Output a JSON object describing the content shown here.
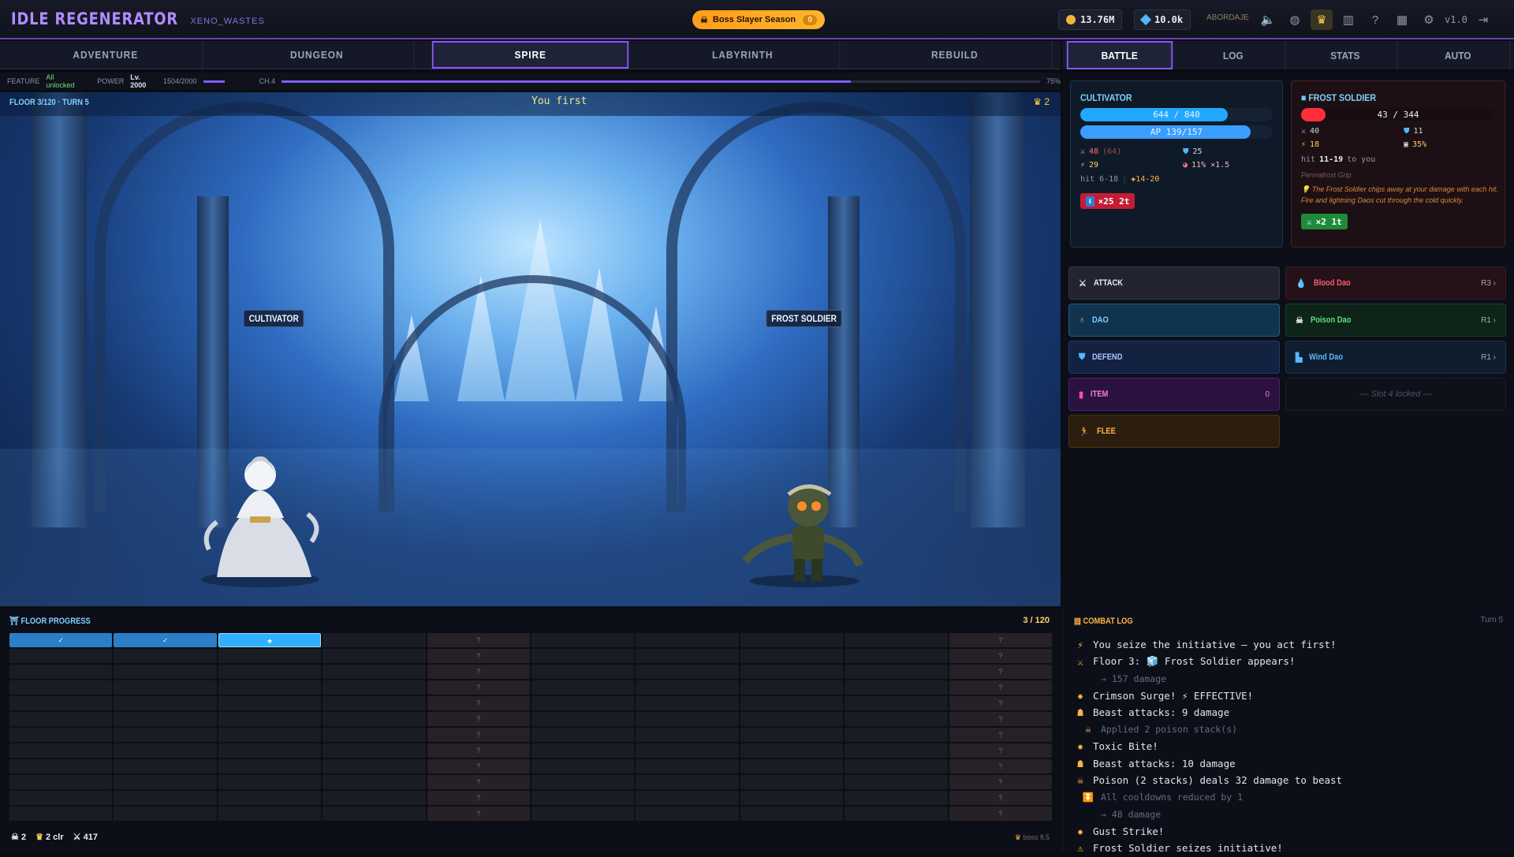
{
  "app": {
    "title": "IDLE REGENERATOR",
    "subtitle": "XENO_WASTES",
    "version": "v1.0"
  },
  "season": {
    "label": "Boss Slayer Season",
    "count": "0"
  },
  "currency": {
    "gold": "13.76M",
    "gems": "10.0k",
    "guild": "ABORDAJE"
  },
  "main_tabs": [
    "ADVENTURE",
    "DUNGEON",
    "SPIRE",
    "LABYRINTH",
    "REBUILD"
  ],
  "active_main_tab": "SPIRE",
  "side_tabs": [
    "BATTLE",
    "LOG",
    "STATS",
    "AUTO"
  ],
  "feature_bar": {
    "feature_label": "FEATURE",
    "feature_value": "All unlocked",
    "power_label": "POWER",
    "level": "Lv. 2000",
    "xp": "1504/2000",
    "chapter": "CH.4",
    "chapter_pct": "75%"
  },
  "arena": {
    "floor_label": "FLOOR 3/120 · TURN 5",
    "turn_banner": "You first",
    "trophies": "2",
    "player_name": "CULTIVATOR",
    "enemy_name": "FROST SOLDIER"
  },
  "player": {
    "name": "CULTIVATOR",
    "hp_text": "644 / 840",
    "hp_pct": 0.767,
    "ap_text": "AP 139/157",
    "ap_pct": 0.885,
    "atk": "48",
    "atk_base": "(64)",
    "def": "25",
    "spd": "29",
    "crit": "11% ×1.5",
    "hit": "hit 6-18",
    "dmg_bonus": "✚14-20",
    "effect": "×25 2t"
  },
  "enemy": {
    "name": "FROST SOLDIER",
    "hp_text": "43 / 344",
    "hp_pct": 0.125,
    "atk": "40",
    "def": "11",
    "spd": "18",
    "block": "35%",
    "hit_prefix": "hit",
    "hit_range": "11-19",
    "hit_suffix": "to you",
    "ability": "Permafrost Grip",
    "tip": "The Frost Soldier chips away at your damage with each hit. Fire and lightning Daos cut through the cold quickly.",
    "effect": "×2 1t"
  },
  "actions": [
    {
      "label": "ATTACK",
      "icon": "swords-icon",
      "extra": ""
    },
    {
      "label": "DAO",
      "icon": "dao-icon",
      "extra": ""
    },
    {
      "label": "DEFEND",
      "icon": "shield-icon",
      "extra": ""
    },
    {
      "label": "ITEM",
      "icon": "bag-icon",
      "extra": "0"
    },
    {
      "label": "FLEE",
      "icon": "run-icon",
      "extra": ""
    }
  ],
  "daos": [
    {
      "label": "Blood Dao",
      "rank": "R3 ›",
      "color": "#ff5a6e"
    },
    {
      "label": "Poison Dao",
      "rank": "R1 ›",
      "color": "#5fe07a"
    },
    {
      "label": "Wind Dao",
      "rank": "R1 ›",
      "color": "#5ab8ff"
    },
    {
      "label": "— Slot 4 locked —",
      "rank": "",
      "color": "#4b5266"
    }
  ],
  "floor_progress": {
    "title": "FLOOR PROGRESS",
    "count": "3 / 120",
    "done_mark": "✓",
    "current_mark": "★",
    "boss_mark": "?",
    "current": 3,
    "total": 120,
    "footer": {
      "skulls": "2",
      "trophies": "2 clr",
      "kills": "417"
    },
    "boss_note": "boss fl.5"
  },
  "combat_log": {
    "title": "COMBAT LOG",
    "turn": "Turn 5",
    "lines": [
      {
        "icon": "⚡",
        "text": "You seize the initiative — you act first!",
        "dim": false
      },
      {
        "icon": "⚔",
        "text": "Floor 3: 🧊 Frost Soldier appears!",
        "dim": false
      },
      {
        "icon": "",
        "text": "→ 157 damage",
        "dim": true
      },
      {
        "icon": "✸",
        "text": "Crimson Surge! ⚡ EFFECTIVE!",
        "dim": false
      },
      {
        "icon": "☗",
        "text": "Beast attacks: 9 damage",
        "dim": false
      },
      {
        "icon": "☠",
        "text": "Applied 2 poison stack(s)",
        "dim": true
      },
      {
        "icon": "✸",
        "text": "Toxic Bite!",
        "dim": false
      },
      {
        "icon": "☗",
        "text": "Beast attacks: 10 damage",
        "dim": false
      },
      {
        "icon": "☠",
        "text": "Poison (2 stacks) deals 32 damage to beast",
        "dim": false
      },
      {
        "icon": "⏬",
        "text": "All cooldowns reduced by 1",
        "dim": true
      },
      {
        "icon": "",
        "text": "→ 48 damage",
        "dim": true
      },
      {
        "icon": "✸",
        "text": "Gust Strike!",
        "dim": false
      },
      {
        "icon": "⚠",
        "text": "Frost Soldier seizes initiative!",
        "dim": false
      }
    ]
  }
}
